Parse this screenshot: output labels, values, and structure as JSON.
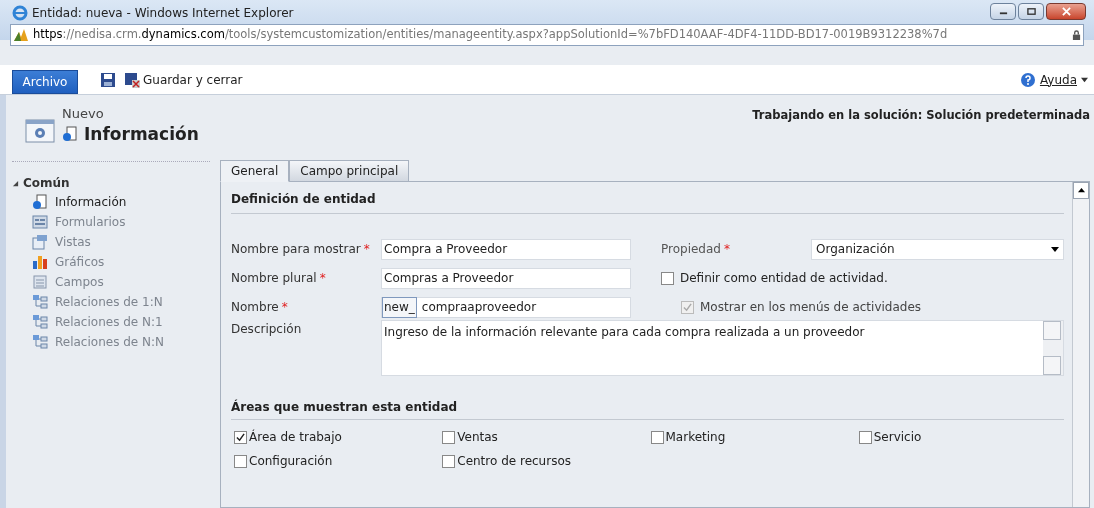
{
  "window": {
    "title": "Entidad: nueva - Windows Internet Explorer"
  },
  "address_bar": {
    "url": "**https**://nedisa.crm.**dynamics.com**/tools/systemcustomization/entities/manageentity.aspx?appSolutionId=%7bFD140AAF-4DF4-11DD-BD17-0019B9312238%7d"
  },
  "ribbon": {
    "file_tab": "Archivo",
    "save_close": "Guardar y cerrar",
    "help": "Ayuda"
  },
  "header": {
    "subtitle": "Nuevo",
    "title": "Información",
    "solution": "Trabajando en la solución: Solución predeterminada"
  },
  "sidebar": {
    "group": "Común",
    "expanded": true,
    "items": [
      {
        "label": "Información",
        "kind": "info",
        "disabled": false
      },
      {
        "label": "Formularios",
        "kind": "form",
        "disabled": true
      },
      {
        "label": "Vistas",
        "kind": "view",
        "disabled": true
      },
      {
        "label": "Gráficos",
        "kind": "chart",
        "disabled": true
      },
      {
        "label": "Campos",
        "kind": "field",
        "disabled": true
      },
      {
        "label": "Relaciones de 1:N",
        "kind": "relation",
        "disabled": true
      },
      {
        "label": "Relaciones de N:1",
        "kind": "relation",
        "disabled": true
      },
      {
        "label": "Relaciones de N:N",
        "kind": "relation",
        "disabled": true
      }
    ]
  },
  "tabs": [
    {
      "label": "General",
      "selected": true
    },
    {
      "label": "Campo principal",
      "selected": false
    }
  ],
  "definition": {
    "title": "Definición de entidad",
    "fields": [
      {
        "label": "Nombre para mostrar",
        "required_mark": "*",
        "value": "Compra a Proveedor"
      },
      {
        "label": "Nombre plural",
        "required_mark": "*",
        "value": "Compras a Proveedor"
      },
      {
        "label": "Nombre",
        "required_mark": "*",
        "prefix": "new_",
        "value": "compraaproveedor"
      }
    ],
    "property": {
      "label": "Propiedad",
      "required_mark": "*",
      "value": "Organización"
    },
    "options": [
      {
        "label": "Definir como entidad de actividad.",
        "checked": false,
        "disabled": false
      },
      {
        "label": "Mostrar en los menús de actividades",
        "checked": true,
        "disabled": true
      }
    ],
    "description": {
      "label": "Descripción",
      "value": "Ingreso de la información relevante para cada compra realizada a un proveedor"
    }
  },
  "areas": {
    "title": "Áreas que muestran esta entidad",
    "options": [
      {
        "label": "Área de trabajo",
        "checked": true
      },
      {
        "label": "Ventas",
        "checked": false
      },
      {
        "label": "Marketing",
        "checked": false
      },
      {
        "label": "Servicio",
        "checked": false
      },
      {
        "label": "Configuración",
        "checked": false
      },
      {
        "label": "Centro de recursos",
        "checked": false
      }
    ]
  }
}
